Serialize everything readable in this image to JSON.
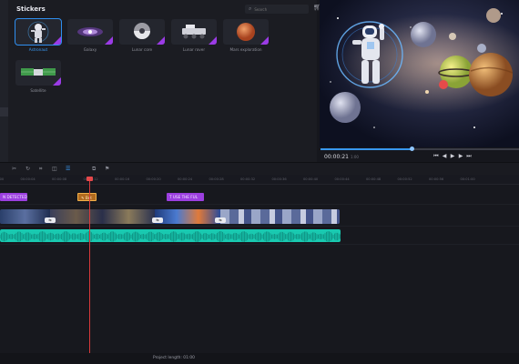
{
  "stickers_panel": {
    "title": "Stickers",
    "search_placeholder": "Search",
    "items": [
      {
        "label": "Astronaut",
        "selected": true
      },
      {
        "label": "Galaxy",
        "selected": false
      },
      {
        "label": "Lunar core",
        "selected": false
      },
      {
        "label": "Lunar rover",
        "selected": false
      },
      {
        "label": "Mars exploration",
        "selected": false
      },
      {
        "label": "Satellite",
        "selected": false
      }
    ]
  },
  "player": {
    "current_time": "00:00:21",
    "total_time": "1:00",
    "progress": 0.46,
    "controls": [
      "skip-to-start",
      "step-back",
      "play",
      "step-forward",
      "skip-to-end"
    ]
  },
  "toolbar": {
    "tools": [
      "cut-icon",
      "redo-icon",
      "crop-icon",
      "stabilize-icon",
      "properties-icon",
      "overlay-icon",
      "flag-icon"
    ],
    "active_tool": "properties-icon"
  },
  "ruler": {
    "ticks": [
      "00:00:00",
      "00:00:04",
      "00:00:08",
      "00:00:12",
      "00:00:16",
      "00:00:20",
      "00:00:24",
      "00:00:28",
      "00:00:32",
      "00:00:36",
      "00:00:40",
      "00:00:44",
      "00:00:48",
      "00:00:52",
      "00:00:56",
      "00:01:00"
    ]
  },
  "tracks": {
    "text_clips": [
      {
        "label": "N DETECTED",
        "style": "purple"
      },
      {
        "label": "Bet",
        "style": "orange"
      },
      {
        "label": "USE THE FUL",
        "style": "purple"
      }
    ],
    "transition_label": "⇆"
  },
  "status": {
    "project_length": "Project length:  01:00"
  },
  "colors": {
    "accent": "#3a9bf5",
    "sticker_badge": "#9b3be6",
    "audio": "#19c9b0",
    "playhead": "#e5484a"
  }
}
